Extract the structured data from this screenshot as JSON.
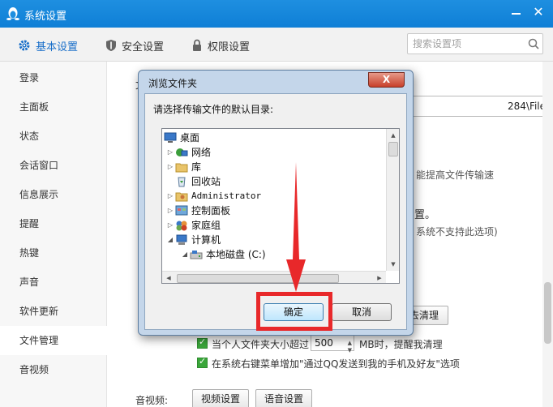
{
  "window": {
    "title": "系统设置",
    "minimize_glyph": "",
    "close_glyph": "✕"
  },
  "tabs": [
    {
      "label": "基本设置",
      "icon": "gear-icon",
      "active": true
    },
    {
      "label": "安全设置",
      "icon": "shield-icon",
      "active": false
    },
    {
      "label": "权限设置",
      "icon": "lock-icon",
      "active": false
    }
  ],
  "search": {
    "placeholder": "搜索设置项",
    "icon": "search-icon"
  },
  "sidebar": {
    "items": [
      {
        "label": "登录"
      },
      {
        "label": "主面板"
      },
      {
        "label": "状态"
      },
      {
        "label": "会话窗口"
      },
      {
        "label": "信息展示"
      },
      {
        "label": "提醒"
      },
      {
        "label": "热键"
      },
      {
        "label": "声音"
      },
      {
        "label": "软件更新"
      },
      {
        "label": "文件管理"
      },
      {
        "label": "音视频"
      }
    ],
    "active_index": 9
  },
  "content": {
    "section_label_fragment": "文",
    "path_value": "284\\FileRecv\\",
    "hint_speed": "能提高文件传输速",
    "hint_settings": "置。",
    "hint_unsupported": "系统不支持此选项)",
    "clean_button_fragment": "去清理",
    "option_size_prefix": "当个人文件夹大小超过",
    "size_value": "500",
    "option_size_suffix": "MB时，提醒我清理",
    "option_context_menu": "在系统右键菜单增加\"通过QQ发送到我的手机及好友\"选项",
    "av_label": "音视频:",
    "video_button": "视频设置",
    "audio_button": "语音设置"
  },
  "dialog": {
    "title": "浏览文件夹",
    "close_glyph": "X",
    "prompt": "请选择传输文件的默认目录:",
    "tree": [
      {
        "label": "桌面",
        "icon": "desktop-icon",
        "expander": ""
      },
      {
        "label": "网络",
        "icon": "network-icon",
        "expander": "▷"
      },
      {
        "label": "库",
        "icon": "library-folder-icon",
        "expander": "▷"
      },
      {
        "label": "回收站",
        "icon": "recycle-bin-icon",
        "expander": ""
      },
      {
        "label": "Administrator",
        "icon": "user-folder-icon",
        "expander": "▷"
      },
      {
        "label": "控制面板",
        "icon": "control-panel-icon",
        "expander": "▷"
      },
      {
        "label": "家庭组",
        "icon": "homegroup-icon",
        "expander": "▷"
      },
      {
        "label": "计算机",
        "icon": "computer-icon",
        "expander": "◢"
      },
      {
        "label": "本地磁盘 (C:)",
        "icon": "drive-icon",
        "expander": "◢"
      }
    ],
    "ok_button": "确定",
    "cancel_button": "取消"
  },
  "colors": {
    "title_blue": "#1e8fe0",
    "active_tab": "#1a6fc9",
    "checkbox_green": "#3aa63a",
    "annotation_red": "#e8282a"
  }
}
